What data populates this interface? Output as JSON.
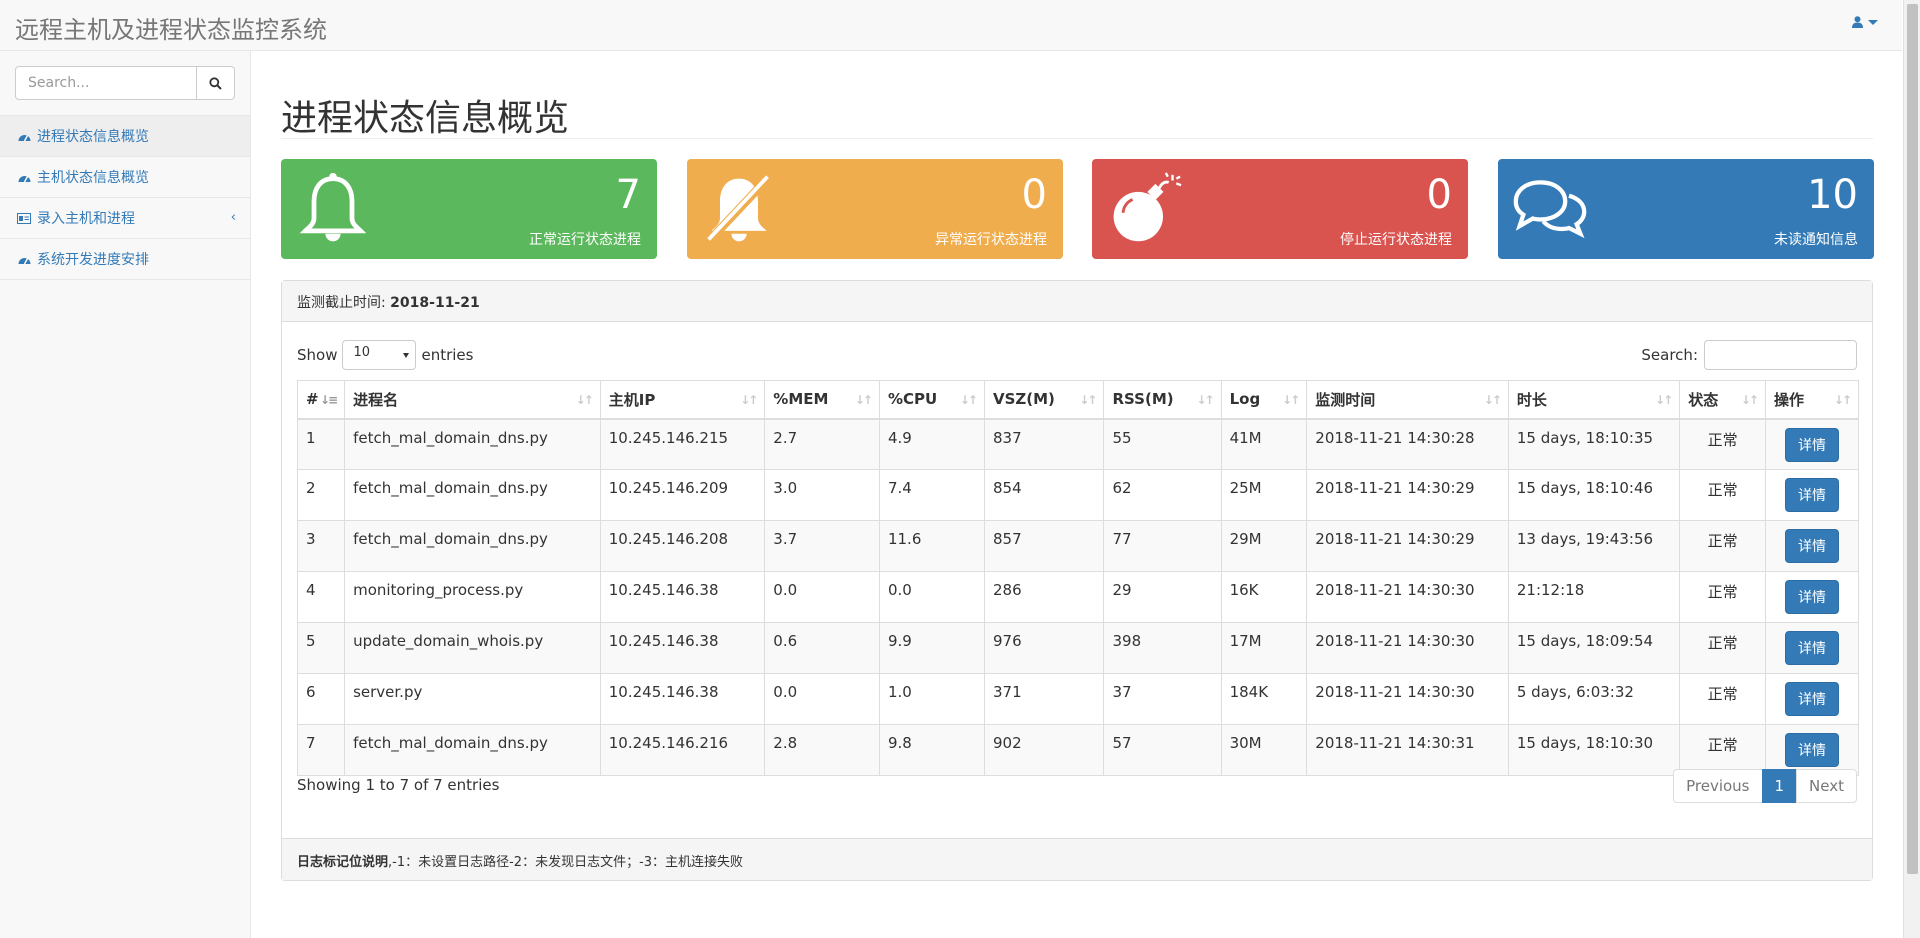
{
  "app": {
    "title": "远程主机及进程状态监控系统",
    "user_icon": "user-icon"
  },
  "sidebar": {
    "search_placeholder": "Search...",
    "items": [
      {
        "label": "进程状态信息概览",
        "icon": "dashboard-icon",
        "active": true
      },
      {
        "label": "主机状态信息概览",
        "icon": "dashboard-icon"
      },
      {
        "label": "录入主机和进程",
        "icon": "id-card-icon",
        "expand": "‹"
      },
      {
        "label": "系统开发进度安排",
        "icon": "dashboard-icon"
      }
    ]
  },
  "page": {
    "title": "进程状态信息概览"
  },
  "stats": [
    {
      "value": "7",
      "label": "正常运行状态进程",
      "icon": "bell-icon",
      "color": "#5cb85c"
    },
    {
      "value": "0",
      "label": "异常运行状态进程",
      "icon": "bell-slash-icon",
      "color": "#f0ad4e"
    },
    {
      "value": "0",
      "label": "停止运行状态进程",
      "icon": "bomb-icon",
      "color": "#d9534f"
    },
    {
      "value": "10",
      "label": "未读通知信息",
      "icon": "comments-icon",
      "color": "#337ab7"
    }
  ],
  "card": {
    "header_label": "监测截止时间: ",
    "header_date": "2018-11-21",
    "show_label": "Show",
    "length_value": "10",
    "entries_label": "entries",
    "search_label": "Search:",
    "info": "Showing 1 to 7 of 7 entries",
    "footer_bold": "日志标记位说明",
    "footer_text": ",-1：未设置日志路径-2：未发现日志文件；-3：主机连接失败"
  },
  "pagination": {
    "previous": "Previous",
    "current": "1",
    "next": "Next"
  },
  "table": {
    "columns": [
      "#",
      "进程名",
      "主机IP",
      "%MEM",
      "%CPU",
      "VSZ(M)",
      "RSS(M)",
      "Log",
      "监测时间",
      "时长",
      "状态",
      "操作"
    ],
    "detail_label": "详情",
    "rows": [
      [
        "1",
        "fetch_mal_domain_dns.py",
        "10.245.146.215",
        "2.7",
        "4.9",
        "837",
        "55",
        "41M",
        "2018-11-21 14:30:28",
        "15 days, 18:10:35",
        "正常"
      ],
      [
        "2",
        "fetch_mal_domain_dns.py",
        "10.245.146.209",
        "3.0",
        "7.4",
        "854",
        "62",
        "25M",
        "2018-11-21 14:30:29",
        "15 days, 18:10:46",
        "正常"
      ],
      [
        "3",
        "fetch_mal_domain_dns.py",
        "10.245.146.208",
        "3.7",
        "11.6",
        "857",
        "77",
        "29M",
        "2018-11-21 14:30:29",
        "13 days, 19:43:56",
        "正常"
      ],
      [
        "4",
        "monitoring_process.py",
        "10.245.146.38",
        "0.0",
        "0.0",
        "286",
        "29",
        "16K",
        "2018-11-21 14:30:30",
        "21:12:18",
        "正常"
      ],
      [
        "5",
        "update_domain_whois.py",
        "10.245.146.38",
        "0.6",
        "9.9",
        "976",
        "398",
        "17M",
        "2018-11-21 14:30:30",
        "15 days, 18:09:54",
        "正常"
      ],
      [
        "6",
        "server.py",
        "10.245.146.38",
        "0.0",
        "1.0",
        "371",
        "37",
        "184K",
        "2018-11-21 14:30:30",
        "5 days, 6:03:32",
        "正常"
      ],
      [
        "7",
        "fetch_mal_domain_dns.py",
        "10.245.146.216",
        "2.8",
        "9.8",
        "902",
        "57",
        "30M",
        "2018-11-21 14:30:31",
        "15 days, 18:10:30",
        "正常"
      ]
    ]
  }
}
